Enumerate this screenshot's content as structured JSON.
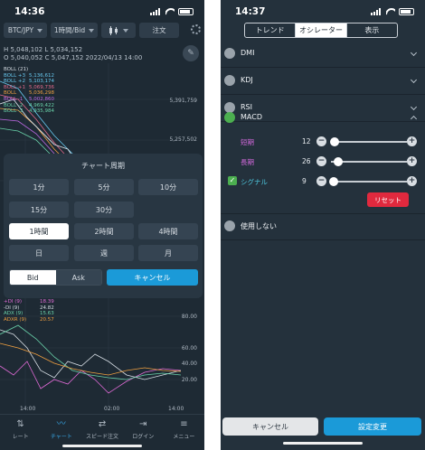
{
  "colors": {
    "bg": "#1e2a34",
    "panel": "#283642",
    "accent": "#1b9ad8",
    "reset": "#e0293e",
    "green": "#4caf50"
  },
  "left": {
    "status_time": "14:36",
    "toolbar": {
      "pair": "BTC/JPY",
      "interval": "1時間/Bid",
      "candle_icon": "candlestick-icon",
      "order": "注文"
    },
    "ohlc_line1": "H 5,048,102  L 5,034,152",
    "ohlc_line2": "O 5,040,052  C 5,047,152  2022/04/13 14:00",
    "legend": [
      {
        "name": "BOLL (21)",
        "value": "",
        "color": "#d6dde4"
      },
      {
        "name": "BOLL +3",
        "value": "5,136,612",
        "color": "#68c9f0"
      },
      {
        "name": "BOLL +2",
        "value": "5,103,174",
        "color": "#68c9f0"
      },
      {
        "name": "BOLL +1",
        "value": "5,069,736",
        "color": "#e0698a"
      },
      {
        "name": "BOLL",
        "value": "5,036,298",
        "color": "#f0a040"
      },
      {
        "name": "BOLL -1",
        "value": "5,002,860",
        "color": "#c06ae6"
      },
      {
        "name": "BOLL -2",
        "value": "4,969,422",
        "color": "#6ad2aa"
      },
      {
        "name": "BOLL -3",
        "value": "4,935,984",
        "color": "#6ad2aa"
      }
    ],
    "y_labels": [
      "5,391,759",
      "5,257,502"
    ],
    "y_labels_ind": [
      "80.00",
      "60.00",
      "40.00",
      "20.00"
    ],
    "x_labels": [
      "14:00",
      "02:00",
      "14:00"
    ],
    "indicators": [
      {
        "name": "+DI (9)",
        "value": "18.39",
        "color": "#e06ad6"
      },
      {
        "name": "-DI (9)",
        "value": "24.82",
        "color": "#d6dde4"
      },
      {
        "name": "ADX (9)",
        "value": "15.63",
        "color": "#6ad2aa"
      },
      {
        "name": "ADXR (9)",
        "value": "20.57",
        "color": "#f0a040"
      }
    ],
    "modal": {
      "title": "チャート周期",
      "periods": [
        [
          "1分",
          "5分",
          "10分"
        ],
        [
          "15分",
          "30分",
          ""
        ],
        [
          "1時間",
          "2時間",
          "4時間"
        ],
        [
          "日",
          "週",
          "月"
        ]
      ],
      "selected": "1時間",
      "bid": "Bid",
      "ask": "Ask",
      "cancel": "キャンセル"
    },
    "nav": [
      {
        "label": "レート",
        "icon": "rate-arrows-icon"
      },
      {
        "label": "チャート",
        "icon": "chart-line-icon"
      },
      {
        "label": "スピード注文",
        "icon": "speed-order-icon"
      },
      {
        "label": "ログイン",
        "icon": "login-icon"
      },
      {
        "label": "メニュー",
        "icon": "menu-icon"
      }
    ]
  },
  "right": {
    "status_time": "14:37",
    "tabs": [
      "トレンド",
      "オシレーター",
      "表示"
    ],
    "active_tab": "オシレーター",
    "indicators": [
      "DMI",
      "KDJ",
      "RSI",
      "MACD"
    ],
    "selected_indicator": "MACD",
    "params": [
      {
        "label": "短期",
        "value": "12",
        "color": "#d66ae0",
        "fraction": 0.05
      },
      {
        "label": "長期",
        "value": "26",
        "color": "#d66ae0",
        "fraction": 0.1
      },
      {
        "label": "シグナル",
        "value": "9",
        "color": "#4ec9e0",
        "fraction": 0.03,
        "checked": true
      }
    ],
    "reset": "リセット",
    "none": "使用しない",
    "cancel": "キャンセル",
    "apply": "設定変更"
  }
}
